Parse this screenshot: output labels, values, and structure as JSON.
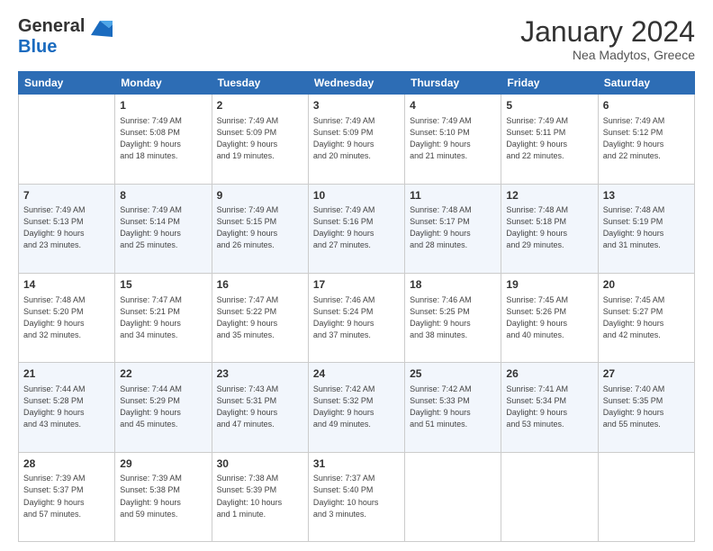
{
  "logo": {
    "general": "General",
    "blue": "Blue"
  },
  "title": "January 2024",
  "location": "Nea Madytos, Greece",
  "headers": [
    "Sunday",
    "Monday",
    "Tuesday",
    "Wednesday",
    "Thursday",
    "Friday",
    "Saturday"
  ],
  "weeks": [
    [
      {
        "day": "",
        "info": ""
      },
      {
        "day": "1",
        "info": "Sunrise: 7:49 AM\nSunset: 5:08 PM\nDaylight: 9 hours\nand 18 minutes."
      },
      {
        "day": "2",
        "info": "Sunrise: 7:49 AM\nSunset: 5:09 PM\nDaylight: 9 hours\nand 19 minutes."
      },
      {
        "day": "3",
        "info": "Sunrise: 7:49 AM\nSunset: 5:09 PM\nDaylight: 9 hours\nand 20 minutes."
      },
      {
        "day": "4",
        "info": "Sunrise: 7:49 AM\nSunset: 5:10 PM\nDaylight: 9 hours\nand 21 minutes."
      },
      {
        "day": "5",
        "info": "Sunrise: 7:49 AM\nSunset: 5:11 PM\nDaylight: 9 hours\nand 22 minutes."
      },
      {
        "day": "6",
        "info": "Sunrise: 7:49 AM\nSunset: 5:12 PM\nDaylight: 9 hours\nand 22 minutes."
      }
    ],
    [
      {
        "day": "7",
        "info": "Sunrise: 7:49 AM\nSunset: 5:13 PM\nDaylight: 9 hours\nand 23 minutes."
      },
      {
        "day": "8",
        "info": "Sunrise: 7:49 AM\nSunset: 5:14 PM\nDaylight: 9 hours\nand 25 minutes."
      },
      {
        "day": "9",
        "info": "Sunrise: 7:49 AM\nSunset: 5:15 PM\nDaylight: 9 hours\nand 26 minutes."
      },
      {
        "day": "10",
        "info": "Sunrise: 7:49 AM\nSunset: 5:16 PM\nDaylight: 9 hours\nand 27 minutes."
      },
      {
        "day": "11",
        "info": "Sunrise: 7:48 AM\nSunset: 5:17 PM\nDaylight: 9 hours\nand 28 minutes."
      },
      {
        "day": "12",
        "info": "Sunrise: 7:48 AM\nSunset: 5:18 PM\nDaylight: 9 hours\nand 29 minutes."
      },
      {
        "day": "13",
        "info": "Sunrise: 7:48 AM\nSunset: 5:19 PM\nDaylight: 9 hours\nand 31 minutes."
      }
    ],
    [
      {
        "day": "14",
        "info": "Sunrise: 7:48 AM\nSunset: 5:20 PM\nDaylight: 9 hours\nand 32 minutes."
      },
      {
        "day": "15",
        "info": "Sunrise: 7:47 AM\nSunset: 5:21 PM\nDaylight: 9 hours\nand 34 minutes."
      },
      {
        "day": "16",
        "info": "Sunrise: 7:47 AM\nSunset: 5:22 PM\nDaylight: 9 hours\nand 35 minutes."
      },
      {
        "day": "17",
        "info": "Sunrise: 7:46 AM\nSunset: 5:24 PM\nDaylight: 9 hours\nand 37 minutes."
      },
      {
        "day": "18",
        "info": "Sunrise: 7:46 AM\nSunset: 5:25 PM\nDaylight: 9 hours\nand 38 minutes."
      },
      {
        "day": "19",
        "info": "Sunrise: 7:45 AM\nSunset: 5:26 PM\nDaylight: 9 hours\nand 40 minutes."
      },
      {
        "day": "20",
        "info": "Sunrise: 7:45 AM\nSunset: 5:27 PM\nDaylight: 9 hours\nand 42 minutes."
      }
    ],
    [
      {
        "day": "21",
        "info": "Sunrise: 7:44 AM\nSunset: 5:28 PM\nDaylight: 9 hours\nand 43 minutes."
      },
      {
        "day": "22",
        "info": "Sunrise: 7:44 AM\nSunset: 5:29 PM\nDaylight: 9 hours\nand 45 minutes."
      },
      {
        "day": "23",
        "info": "Sunrise: 7:43 AM\nSunset: 5:31 PM\nDaylight: 9 hours\nand 47 minutes."
      },
      {
        "day": "24",
        "info": "Sunrise: 7:42 AM\nSunset: 5:32 PM\nDaylight: 9 hours\nand 49 minutes."
      },
      {
        "day": "25",
        "info": "Sunrise: 7:42 AM\nSunset: 5:33 PM\nDaylight: 9 hours\nand 51 minutes."
      },
      {
        "day": "26",
        "info": "Sunrise: 7:41 AM\nSunset: 5:34 PM\nDaylight: 9 hours\nand 53 minutes."
      },
      {
        "day": "27",
        "info": "Sunrise: 7:40 AM\nSunset: 5:35 PM\nDaylight: 9 hours\nand 55 minutes."
      }
    ],
    [
      {
        "day": "28",
        "info": "Sunrise: 7:39 AM\nSunset: 5:37 PM\nDaylight: 9 hours\nand 57 minutes."
      },
      {
        "day": "29",
        "info": "Sunrise: 7:39 AM\nSunset: 5:38 PM\nDaylight: 9 hours\nand 59 minutes."
      },
      {
        "day": "30",
        "info": "Sunrise: 7:38 AM\nSunset: 5:39 PM\nDaylight: 10 hours\nand 1 minute."
      },
      {
        "day": "31",
        "info": "Sunrise: 7:37 AM\nSunset: 5:40 PM\nDaylight: 10 hours\nand 3 minutes."
      },
      {
        "day": "",
        "info": ""
      },
      {
        "day": "",
        "info": ""
      },
      {
        "day": "",
        "info": ""
      }
    ]
  ]
}
